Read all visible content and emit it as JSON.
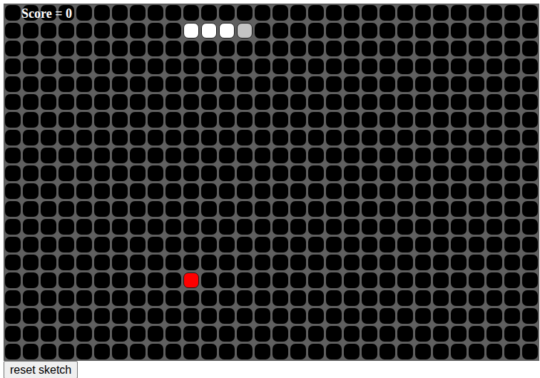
{
  "score": "Score = 0",
  "board": {
    "columns": 30,
    "rows": 20
  },
  "snake": [
    {
      "col": 10,
      "row": 1,
      "kind": "body"
    },
    {
      "col": 11,
      "row": 1,
      "kind": "body"
    },
    {
      "col": 12,
      "row": 1,
      "kind": "body"
    },
    {
      "col": 13,
      "row": 1,
      "kind": "head"
    }
  ],
  "food": {
    "col": 10,
    "row": 15,
    "color": "#ff0000"
  },
  "buttons": [
    "reset sketch"
  ]
}
